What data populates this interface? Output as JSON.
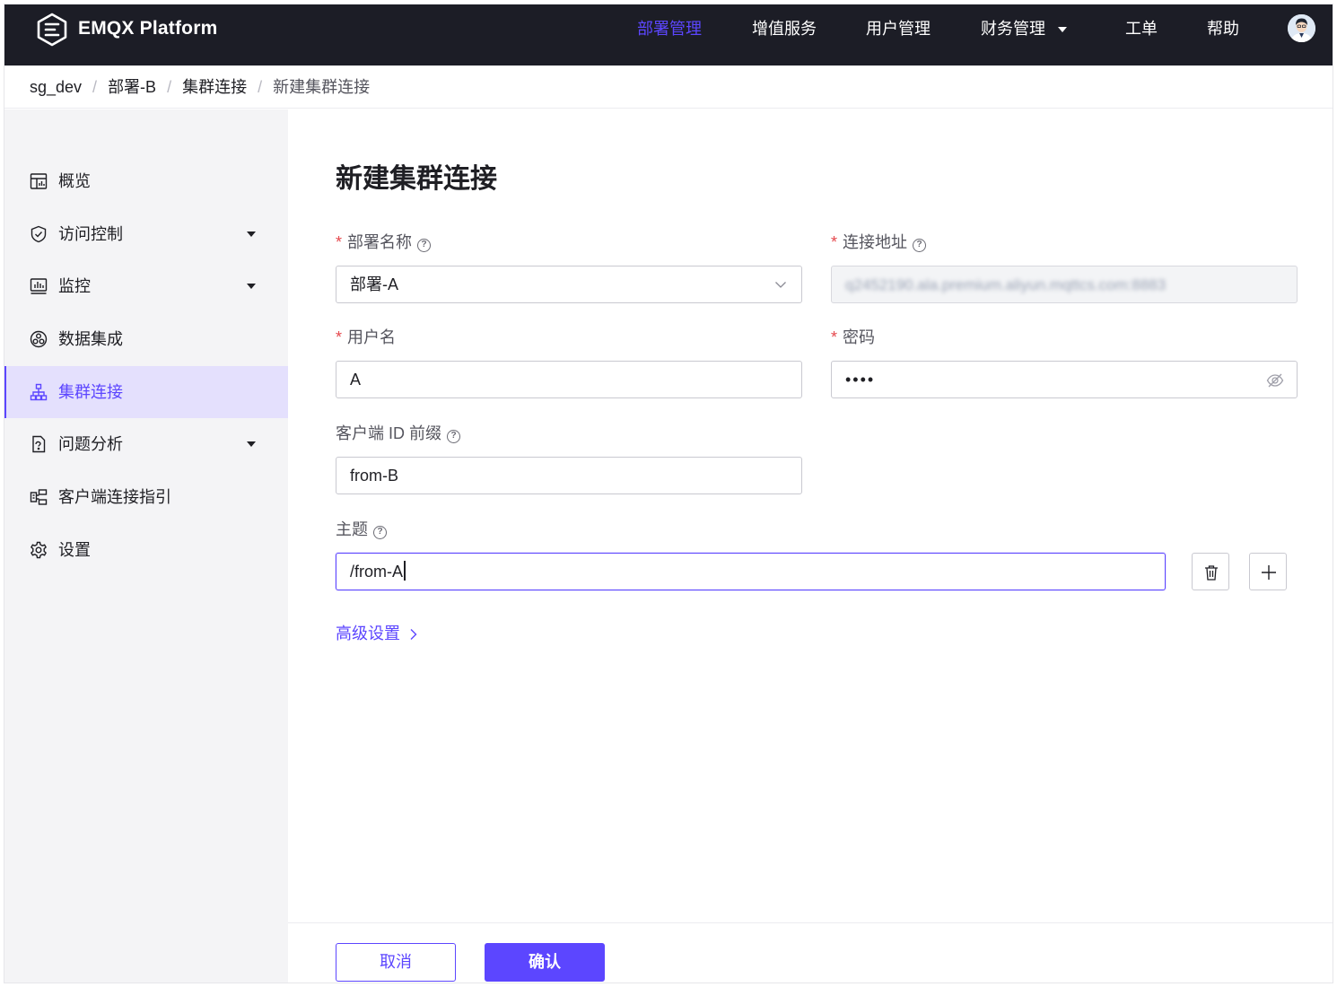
{
  "brand": {
    "name": "EMQX Platform",
    "logo_icon": "emqx-logo-icon"
  },
  "nav": {
    "items": [
      {
        "label": "部署管理",
        "active": true
      },
      {
        "label": "增值服务"
      },
      {
        "label": "用户管理"
      },
      {
        "label": "财务管理",
        "dropdown": true
      },
      {
        "label": "工单"
      },
      {
        "label": "帮助"
      }
    ]
  },
  "breadcrumb": [
    "sg_dev",
    "部署-B",
    "集群连接",
    "新建集群连接"
  ],
  "sidebar": {
    "items": [
      {
        "label": "概览",
        "icon": "dashboard-icon"
      },
      {
        "label": "访问控制",
        "icon": "shield-icon",
        "dropdown": true
      },
      {
        "label": "监控",
        "icon": "monitor-icon",
        "dropdown": true
      },
      {
        "label": "数据集成",
        "icon": "data-integration-icon"
      },
      {
        "label": "集群连接",
        "icon": "cluster-icon",
        "active": true
      },
      {
        "label": "问题分析",
        "icon": "diagnose-icon",
        "dropdown": true
      },
      {
        "label": "客户端连接指引",
        "icon": "client-guide-icon"
      },
      {
        "label": "设置",
        "icon": "gear-icon"
      }
    ]
  },
  "form": {
    "title": "新建集群连接",
    "deployment_name": {
      "label": "部署名称",
      "required": true,
      "value": "部署-A"
    },
    "address": {
      "label": "连接地址",
      "required": true,
      "value": "q2452190.ala.premium.aliyun.mqttcs.com:8883"
    },
    "username": {
      "label": "用户名",
      "required": true,
      "value": "A"
    },
    "password": {
      "label": "密码",
      "required": true,
      "value": "••••"
    },
    "client_id_prefix": {
      "label": "客户端 ID 前缀",
      "value": "from-B"
    },
    "topic": {
      "label": "主题",
      "value": "/from-A"
    },
    "advanced": "高级设置",
    "cancel": "取消",
    "confirm": "确认"
  },
  "colors": {
    "accent": "#5c46ff",
    "nav_bg": "#1c1d26",
    "required": "#e5484d",
    "sidebar_bg": "#f4f4f6",
    "active_bg": "#e4e0fd"
  }
}
